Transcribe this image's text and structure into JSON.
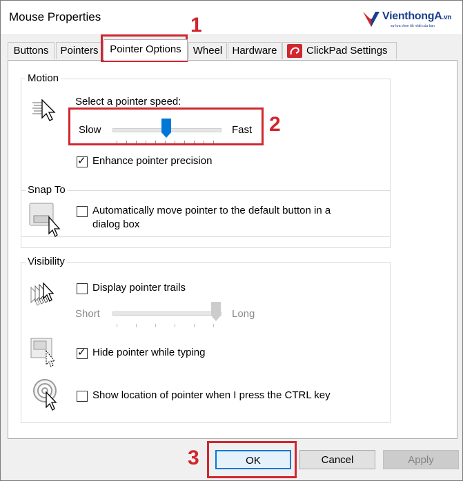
{
  "window": {
    "title": "Mouse Properties"
  },
  "logo": {
    "brand": "VienthongA",
    "suffix": ".vn",
    "tagline": "sự lựa chọn tốt nhất của bạn"
  },
  "tabs": [
    {
      "label": "Buttons",
      "active": false
    },
    {
      "label": "Pointers",
      "active": false
    },
    {
      "label": "Pointer Options",
      "active": true
    },
    {
      "label": "Wheel",
      "active": false
    },
    {
      "label": "Hardware",
      "active": false
    },
    {
      "label": "ClickPad Settings",
      "active": false,
      "icon": "synaptics-icon"
    }
  ],
  "motion": {
    "group_label": "Motion",
    "speed_prompt": "Select a pointer speed:",
    "slow_label": "Slow",
    "fast_label": "Fast",
    "speed_level": 0.5,
    "enhance_label": "Enhance pointer precision",
    "enhance_checked": true
  },
  "snap_to": {
    "group_label": "Snap To",
    "auto_move_label_line1": "Automatically move pointer to the default button in a",
    "auto_move_label_line2": "dialog box",
    "auto_move_checked": false
  },
  "visibility": {
    "group_label": "Visibility",
    "trails_label": "Display pointer trails",
    "trails_checked": false,
    "short_label": "Short",
    "long_label": "Long",
    "trails_level": 1.0,
    "hide_label": "Hide pointer while typing",
    "hide_checked": true,
    "show_location_label": "Show location of pointer when I press the CTRL key",
    "show_location_checked": false
  },
  "buttons": {
    "ok": "OK",
    "cancel": "Cancel",
    "apply": "Apply"
  },
  "annotations": {
    "n1": "1",
    "n2": "2",
    "n3": "3",
    "color": "#d0262e"
  },
  "colors": {
    "accent": "#0078d7",
    "window_bg": "#f0f0f0"
  },
  "check_glyph": "✓"
}
